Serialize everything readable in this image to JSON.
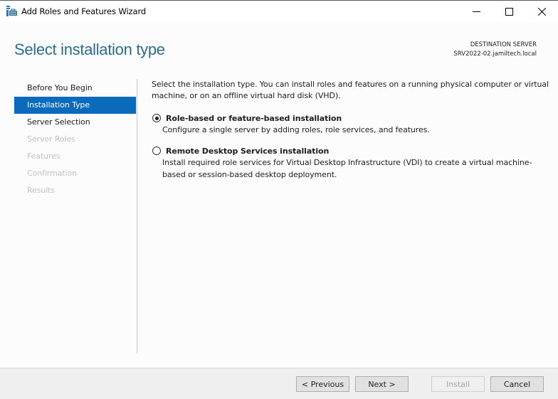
{
  "window": {
    "title": "Add Roles and Features Wizard",
    "controls": {
      "minimize": "minimize-icon",
      "maximize": "maximize-icon",
      "close": "close-icon"
    }
  },
  "header": {
    "page_title": "Select installation type",
    "destination_label": "DESTINATION SERVER",
    "destination_server": "SRV2022-02.jamiltech.local"
  },
  "sidebar": {
    "items": [
      {
        "label": "Before You Begin",
        "state": "normal"
      },
      {
        "label": "Installation Type",
        "state": "active"
      },
      {
        "label": "Server Selection",
        "state": "normal"
      },
      {
        "label": "Server Roles",
        "state": "disabled"
      },
      {
        "label": "Features",
        "state": "disabled"
      },
      {
        "label": "Confirmation",
        "state": "disabled"
      },
      {
        "label": "Results",
        "state": "disabled"
      }
    ]
  },
  "main": {
    "intro": "Select the installation type. You can install roles and features on a running physical computer or virtual machine, or on an offline virtual hard disk (VHD).",
    "options": [
      {
        "label": "Role-based or feature-based installation",
        "description": "Configure a single server by adding roles, role services, and features.",
        "selected": true
      },
      {
        "label": "Remote Desktop Services installation",
        "description": "Install required role services for Virtual Desktop Infrastructure (VDI) to create a virtual machine-based or session-based desktop deployment.",
        "selected": false
      }
    ]
  },
  "footer": {
    "previous": "< Previous",
    "next": "Next >",
    "install": "Install",
    "cancel": "Cancel"
  },
  "colors": {
    "accent": "#0a6bbd",
    "title": "#2a6e8c",
    "disabled_text": "#c2c2c2"
  }
}
